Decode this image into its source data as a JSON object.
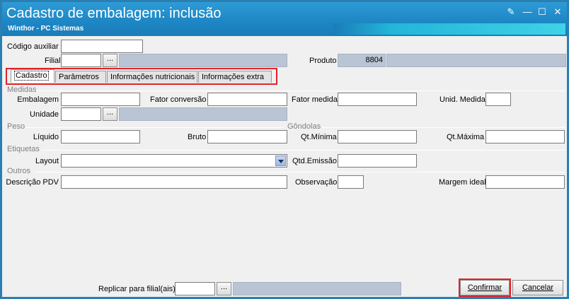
{
  "window": {
    "title": "Cadastro de embalagem: inclusão",
    "subtitle": "Winthor - PC Sistemas",
    "controls": {
      "edit": "✎",
      "minimize": "—",
      "maximize": "☐",
      "close": "✕"
    }
  },
  "header": {
    "codigo_auxiliar_label": "Código auxiliar",
    "codigo_auxiliar_value": "",
    "filial_label": "Filial",
    "filial_value": "",
    "filial_button": "...",
    "produto_label": "Produto",
    "produto_code": "8804",
    "produto_desc": ""
  },
  "tabs": [
    {
      "label": "Cadastro",
      "active": true
    },
    {
      "label": "Parâmetros",
      "active": false
    },
    {
      "label": "Informações nutricionais",
      "active": false
    },
    {
      "label": "Informações extra",
      "active": false
    }
  ],
  "medidas": {
    "section": "Medidas",
    "embalagem_label": "Embalagem",
    "fator_conversao_label": "Fator conversão",
    "fator_medida_label": "Fator medida",
    "unid_medida_label": "Unid. Medida",
    "unidade_label": "Unidade",
    "unidade_button": "..."
  },
  "peso": {
    "section": "Peso",
    "liquido_label": "Líquido",
    "bruto_label": "Bruto"
  },
  "gondolas": {
    "section": "Gôndolas",
    "qt_minima_label": "Qt.Mínima",
    "qt_maxima_label": "Qt.Máxima"
  },
  "etiquetas": {
    "section": "Etiquetas",
    "layout_label": "Layout",
    "layout_value": "",
    "qtd_emissao_label": "Qtd.Emissão"
  },
  "outros": {
    "section": "Outros",
    "descricao_pdv_label": "Descrição PDV",
    "observacao_label": "Observação",
    "margem_ideal_label": "Margem ideal"
  },
  "footer": {
    "replicar_label": "Replicar para filial(ais)",
    "replicar_button": "...",
    "confirmar_label": "Confirmar",
    "cancelar_label": "Cancelar"
  },
  "colors": {
    "titlebar": "#1d86c4",
    "readonly": "#b9c4d4",
    "highlight": "#e0242a"
  }
}
